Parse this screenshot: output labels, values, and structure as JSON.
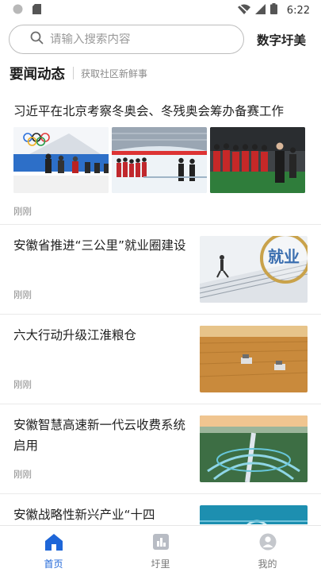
{
  "status_bar": {
    "time": "6:22"
  },
  "search": {
    "placeholder": "请输入搜索内容",
    "value": ""
  },
  "brand": "数字圩美",
  "section": {
    "title": "要闻动态",
    "subtitle": "获取社区新鲜事"
  },
  "feed": {
    "lead": {
      "title": "习近平在北京考察冬奥会、冬残奥会筹办备赛工作",
      "time": "刚刚"
    },
    "items": [
      {
        "title": "安徽省推进“三公里”就业圈建设",
        "time": "刚刚"
      },
      {
        "title": "六大行动升级江淮粮仓",
        "time": "刚刚"
      },
      {
        "title": "安徽智慧高速新一代云收费系统启用",
        "time": "刚刚"
      },
      {
        "title": "安徽战略性新兴产业“十四",
        "time": ""
      }
    ],
    "image_text": {
      "jiuye": "就业"
    }
  },
  "tabbar": {
    "items": [
      {
        "label": "首页",
        "icon": "home-icon",
        "active": true
      },
      {
        "label": "圩里",
        "icon": "village-icon",
        "active": false
      },
      {
        "label": "我的",
        "icon": "profile-icon",
        "active": false
      }
    ]
  },
  "colors": {
    "accent": "#1e66d8",
    "text": "#1f1f1f",
    "muted": "#8c8c8c"
  }
}
